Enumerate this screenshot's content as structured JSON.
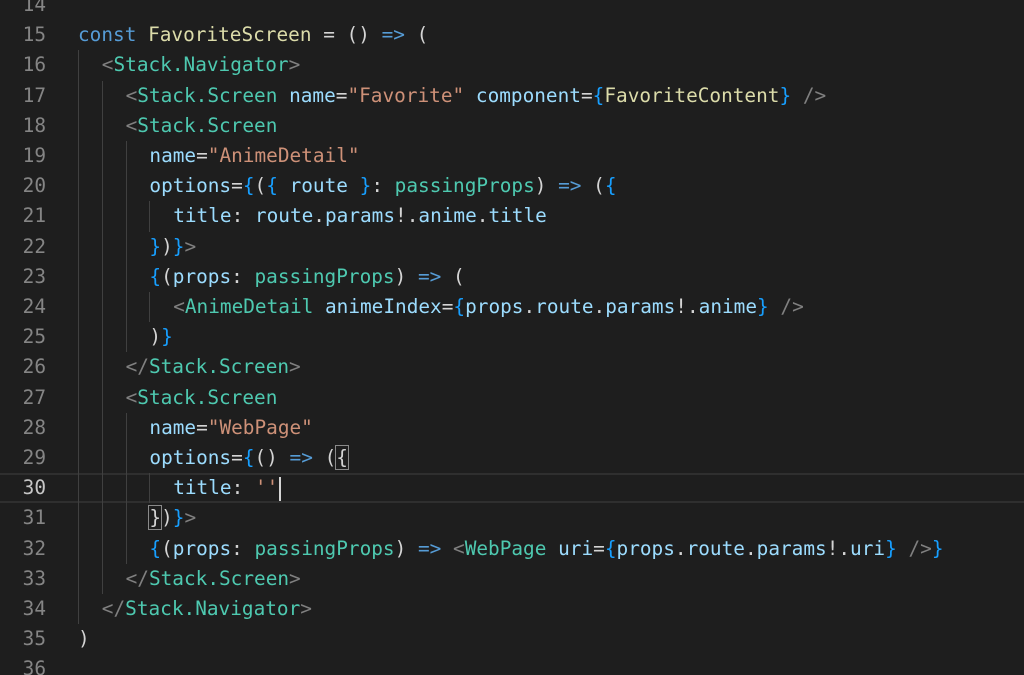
{
  "editor": {
    "language": "typescript-react",
    "cursor_line": 30,
    "colors": {
      "background": "#1e1e1e",
      "keyword": "#569cd6",
      "function": "#dcdcaa",
      "tag_bracket": "#808080",
      "component": "#4ec9b0",
      "attribute": "#9cdcfe",
      "string": "#ce9178",
      "brace": "#179fff",
      "line_number": "#858585"
    },
    "lines": [
      {
        "num": "14",
        "tokens": []
      },
      {
        "num": "15",
        "tokens": [
          [
            "kw",
            "const"
          ],
          [
            "pl",
            " "
          ],
          [
            "fn",
            "FavoriteScreen"
          ],
          [
            "pl",
            " = () "
          ],
          [
            "kw",
            "=>"
          ],
          [
            "pl",
            " ("
          ]
        ]
      },
      {
        "num": "16",
        "tokens": [
          [
            "tg",
            "<"
          ],
          [
            "cp",
            "Stack.Navigator"
          ],
          [
            "tg",
            ">"
          ]
        ]
      },
      {
        "num": "17",
        "tokens": [
          [
            "tg",
            "<"
          ],
          [
            "cp",
            "Stack.Screen"
          ],
          [
            "pl",
            " "
          ],
          [
            "at",
            "name"
          ],
          [
            "pl",
            "="
          ],
          [
            "st",
            "\"Favorite\""
          ],
          [
            "pl",
            " "
          ],
          [
            "at",
            "component"
          ],
          [
            "pl",
            "="
          ],
          [
            "br",
            "{"
          ],
          [
            "fn",
            "FavoriteContent"
          ],
          [
            "br",
            "}"
          ],
          [
            "pl",
            " "
          ],
          [
            "tg",
            "/>"
          ]
        ]
      },
      {
        "num": "18",
        "tokens": [
          [
            "tg",
            "<"
          ],
          [
            "cp",
            "Stack.Screen"
          ]
        ]
      },
      {
        "num": "19",
        "tokens": [
          [
            "at",
            "name"
          ],
          [
            "pl",
            "="
          ],
          [
            "st",
            "\"AnimeDetail\""
          ]
        ]
      },
      {
        "num": "20",
        "tokens": [
          [
            "at",
            "options"
          ],
          [
            "pl",
            "="
          ],
          [
            "br",
            "{"
          ],
          [
            "pl",
            "("
          ],
          [
            "br",
            "{"
          ],
          [
            "pl",
            " "
          ],
          [
            "at",
            "route"
          ],
          [
            "pl",
            " "
          ],
          [
            "br",
            "}"
          ],
          [
            "pl",
            ": "
          ],
          [
            "ty",
            "passingProps"
          ],
          [
            "pl",
            ") "
          ],
          [
            "kw",
            "=>"
          ],
          [
            "pl",
            " ("
          ],
          [
            "br",
            "{"
          ]
        ]
      },
      {
        "num": "21",
        "tokens": [
          [
            "at",
            "title"
          ],
          [
            "pl",
            ": "
          ],
          [
            "at",
            "route"
          ],
          [
            "pl",
            "."
          ],
          [
            "at",
            "params"
          ],
          [
            "pl",
            "!."
          ],
          [
            "at",
            "anime"
          ],
          [
            "pl",
            "."
          ],
          [
            "at",
            "title"
          ]
        ]
      },
      {
        "num": "22",
        "tokens": [
          [
            "br",
            "}"
          ],
          [
            "pl",
            ")"
          ],
          [
            "br",
            "}"
          ],
          [
            "tg",
            ">"
          ]
        ]
      },
      {
        "num": "23",
        "tokens": [
          [
            "br",
            "{"
          ],
          [
            "pl",
            "("
          ],
          [
            "at",
            "props"
          ],
          [
            "pl",
            ": "
          ],
          [
            "ty",
            "passingProps"
          ],
          [
            "pl",
            ") "
          ],
          [
            "kw",
            "=>"
          ],
          [
            "pl",
            " ("
          ]
        ]
      },
      {
        "num": "24",
        "tokens": [
          [
            "tg",
            "<"
          ],
          [
            "cp",
            "AnimeDetail"
          ],
          [
            "pl",
            " "
          ],
          [
            "at",
            "animeIndex"
          ],
          [
            "pl",
            "="
          ],
          [
            "br",
            "{"
          ],
          [
            "at",
            "props"
          ],
          [
            "pl",
            "."
          ],
          [
            "at",
            "route"
          ],
          [
            "pl",
            "."
          ],
          [
            "at",
            "params"
          ],
          [
            "pl",
            "!."
          ],
          [
            "at",
            "anime"
          ],
          [
            "br",
            "}"
          ],
          [
            "pl",
            " "
          ],
          [
            "tg",
            "/>"
          ]
        ]
      },
      {
        "num": "25",
        "tokens": [
          [
            "pl",
            ")"
          ],
          [
            "br",
            "}"
          ]
        ]
      },
      {
        "num": "26",
        "tokens": [
          [
            "tg",
            "</"
          ],
          [
            "cp",
            "Stack.Screen"
          ],
          [
            "tg",
            ">"
          ]
        ]
      },
      {
        "num": "27",
        "tokens": [
          [
            "tg",
            "<"
          ],
          [
            "cp",
            "Stack.Screen"
          ]
        ]
      },
      {
        "num": "28",
        "tokens": [
          [
            "at",
            "name"
          ],
          [
            "pl",
            "="
          ],
          [
            "st",
            "\"WebPage\""
          ]
        ]
      },
      {
        "num": "29",
        "tokens": [
          [
            "at",
            "options"
          ],
          [
            "pl",
            "="
          ],
          [
            "br",
            "{"
          ],
          [
            "pl",
            "() "
          ],
          [
            "kw",
            "=>"
          ],
          [
            "pl",
            " ("
          ],
          [
            "bm",
            "{"
          ]
        ]
      },
      {
        "num": "30",
        "tokens": [
          [
            "at",
            "title"
          ],
          [
            "pl",
            ": "
          ],
          [
            "st",
            "''"
          ]
        ]
      },
      {
        "num": "31",
        "tokens": [
          [
            "bm",
            "}"
          ],
          [
            "pl",
            ")"
          ],
          [
            "br",
            "}"
          ],
          [
            "tg",
            ">"
          ]
        ]
      },
      {
        "num": "32",
        "tokens": [
          [
            "br",
            "{"
          ],
          [
            "pl",
            "("
          ],
          [
            "at",
            "props"
          ],
          [
            "pl",
            ": "
          ],
          [
            "ty",
            "passingProps"
          ],
          [
            "pl",
            ") "
          ],
          [
            "kw",
            "=>"
          ],
          [
            "pl",
            " "
          ],
          [
            "tg",
            "<"
          ],
          [
            "cp",
            "WebPage"
          ],
          [
            "pl",
            " "
          ],
          [
            "at",
            "uri"
          ],
          [
            "pl",
            "="
          ],
          [
            "br",
            "{"
          ],
          [
            "at",
            "props"
          ],
          [
            "pl",
            "."
          ],
          [
            "at",
            "route"
          ],
          [
            "pl",
            "."
          ],
          [
            "at",
            "params"
          ],
          [
            "pl",
            "!."
          ],
          [
            "at",
            "uri"
          ],
          [
            "br",
            "}"
          ],
          [
            "pl",
            " "
          ],
          [
            "tg",
            "/>"
          ],
          [
            "br",
            "}"
          ]
        ]
      },
      {
        "num": "33",
        "tokens": [
          [
            "tg",
            "</"
          ],
          [
            "cp",
            "Stack.Screen"
          ],
          [
            "tg",
            ">"
          ]
        ]
      },
      {
        "num": "34",
        "tokens": [
          [
            "tg",
            "</"
          ],
          [
            "cp",
            "Stack.Navigator"
          ],
          [
            "tg",
            ">"
          ]
        ]
      },
      {
        "num": "35",
        "tokens": [
          [
            "pl",
            ")"
          ]
        ]
      },
      {
        "num": "36",
        "tokens": []
      }
    ]
  }
}
